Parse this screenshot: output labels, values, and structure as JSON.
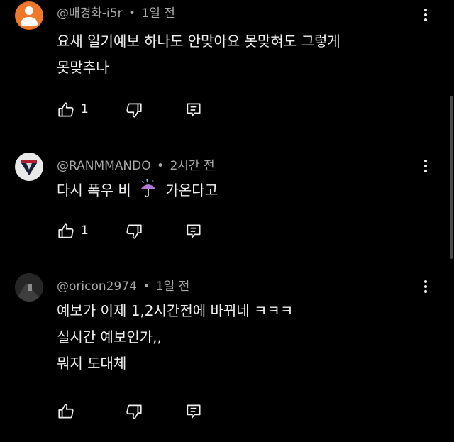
{
  "comments": [
    {
      "author": "@배경화-i5r",
      "separator": "•",
      "time": "1일 전",
      "lines": [
        "요새 일기예보 하나도 안맞아요 못맞혀도 그렇게",
        "못맞추나"
      ],
      "likes": "1",
      "avatar_icon": "default-person-avatar"
    },
    {
      "author": "@RANMMANDO",
      "separator": "•",
      "time": "2시간 전",
      "lines": [
        "다시 폭우 비",
        "가온다고"
      ],
      "likes": "1",
      "avatar_icon": "shield-logo-avatar"
    },
    {
      "author": "@oricon2974",
      "separator": "•",
      "time": "1일 전",
      "lines": [
        "예보가 이제 1,2시간전에 바뀌네 ㅋㅋㅋ",
        "실시간 예보인가,,",
        "뭐지 도대체"
      ],
      "likes": "",
      "avatar_icon": "photo-avatar"
    }
  ],
  "icons": {
    "like": "thumb-up-icon",
    "dislike": "thumb-down-icon",
    "reply": "reply-icon",
    "more": "more-vert-icon",
    "umbrella": "umbrella-with-rain-emoji"
  },
  "colors": {
    "background": "#000000",
    "text_primary": "#f1f1f1",
    "text_secondary": "#aaaaaa",
    "avatar_default": "#f0782a"
  }
}
